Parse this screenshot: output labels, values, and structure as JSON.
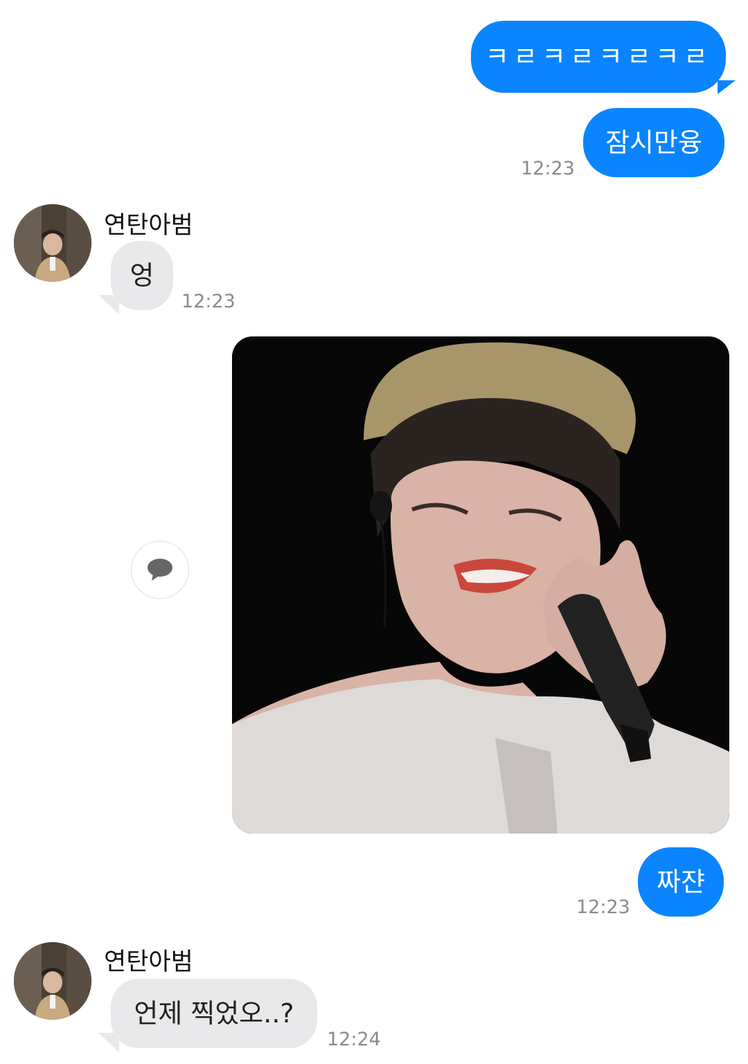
{
  "colors": {
    "outgoing_bubble": "#0a84ff",
    "incoming_bubble": "#e9e9eb",
    "timestamp": "#8a8a8e",
    "background": "#ffffff"
  },
  "messages": {
    "out1": {
      "text": "ㅋㄹㅋㄹㅋㄹㅋㄹ"
    },
    "out2": {
      "text": "잠시만융",
      "time": "12:23"
    },
    "in1": {
      "sender": "연탄아범",
      "text": "엉",
      "time": "12:23",
      "avatar_icon": "profile-photo"
    },
    "out_image": {
      "icon": "photo-attachment",
      "reply_icon": "chat-bubble-icon"
    },
    "out3": {
      "text": "짜쟌",
      "time": "12:23"
    },
    "in2": {
      "sender": "연탄아범",
      "text": "언제 찍었오..?",
      "time": "12:24",
      "avatar_icon": "profile-photo"
    }
  }
}
